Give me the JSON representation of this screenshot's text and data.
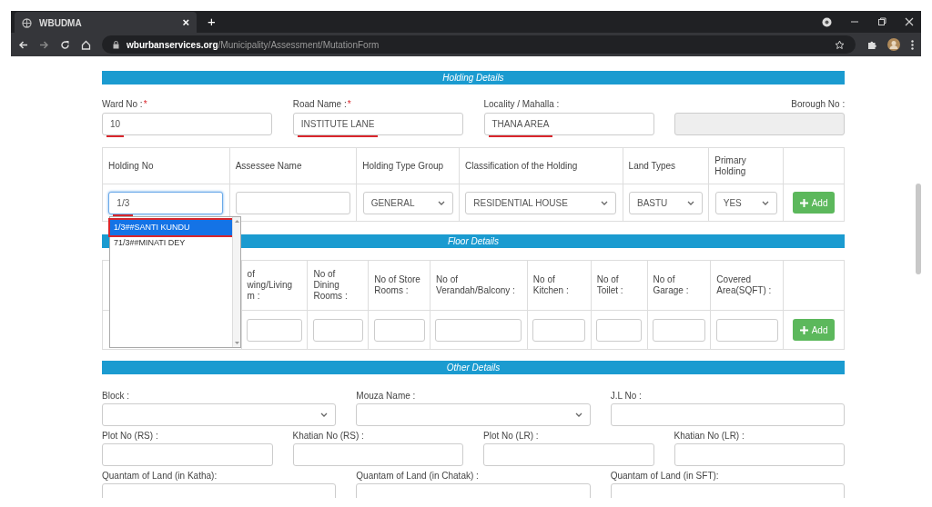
{
  "browser": {
    "tab_title": "WBUDMA",
    "tab_close": "×",
    "new_tab": "+",
    "url_domain": "wburbanservices.org",
    "url_path": "/Municipality/Assessment/MutationForm"
  },
  "holding_details": {
    "title": "Holding Details",
    "fields": [
      {
        "label": "Ward No :",
        "required_mark": "*",
        "value": "10",
        "underlined": true,
        "disabled": false
      },
      {
        "label": "Road Name :",
        "required_mark": "*",
        "value": "INSTITUTE LANE",
        "underlined": true,
        "disabled": false
      },
      {
        "label": "Locality / Mahalla :",
        "value": "THANA AREA",
        "underlined": true,
        "disabled": false
      },
      {
        "label": "Borough No :",
        "disabled": true
      }
    ]
  },
  "holding_table": {
    "columns": [
      "Holding No",
      "Assessee Name",
      "Holding Type Group",
      "Classification of the Holding",
      "Land Types",
      "Primary\nHolding"
    ],
    "cells": [
      {
        "kind": "input",
        "value": "1/3",
        "underlined": true,
        "focused": true
      },
      {
        "kind": "input",
        "focused": false
      },
      {
        "kind": "select",
        "value": "GENERAL"
      },
      {
        "kind": "select",
        "value": "RESIDENTIAL HOUSE"
      },
      {
        "kind": "select",
        "value": "BASTU"
      },
      {
        "kind": "select",
        "value": "YES"
      }
    ],
    "button": "Add"
  },
  "autocomplete": {
    "items": [
      {
        "text": "1/3##SANTI KUNDU",
        "selected": true,
        "outlined": true
      },
      {
        "text": "71/3##MINATI DEY",
        "selected": false,
        "outlined": false
      }
    ]
  },
  "floor_details": {
    "title": "Floor Details",
    "columns": [
      "of\nwing/Living\nm :",
      "No of\nDining\nRooms :",
      "No of Store\nRooms :",
      "No of\nVerandah/Balcony :",
      "No of\nKitchen :",
      "No of\nToilet :",
      "No of\nGarage :",
      "Covered\nArea(SQFT) :"
    ],
    "button": "Add"
  },
  "other_details": {
    "title": "Other Details",
    "rows": [
      [
        {
          "label": "Block :",
          "kind": "select"
        },
        {
          "label": "Mouza Name :",
          "kind": "select"
        },
        {
          "label": "J.L No :",
          "kind": "input"
        }
      ],
      [
        {
          "label": "Plot No (RS) :",
          "kind": "input"
        },
        {
          "label": "Khatian No (RS) :",
          "kind": "input"
        },
        {
          "label": "Plot No (LR) :",
          "kind": "input"
        },
        {
          "label": "Khatian No (LR) :",
          "kind": "input"
        }
      ],
      [
        {
          "label": "Quantam of Land (in Katha):",
          "kind": "input"
        },
        {
          "label": "Quantam of Land (in Chatak) :",
          "kind": "input"
        },
        {
          "label": "Quantam of Land (in SFT):",
          "kind": "input"
        }
      ]
    ]
  }
}
